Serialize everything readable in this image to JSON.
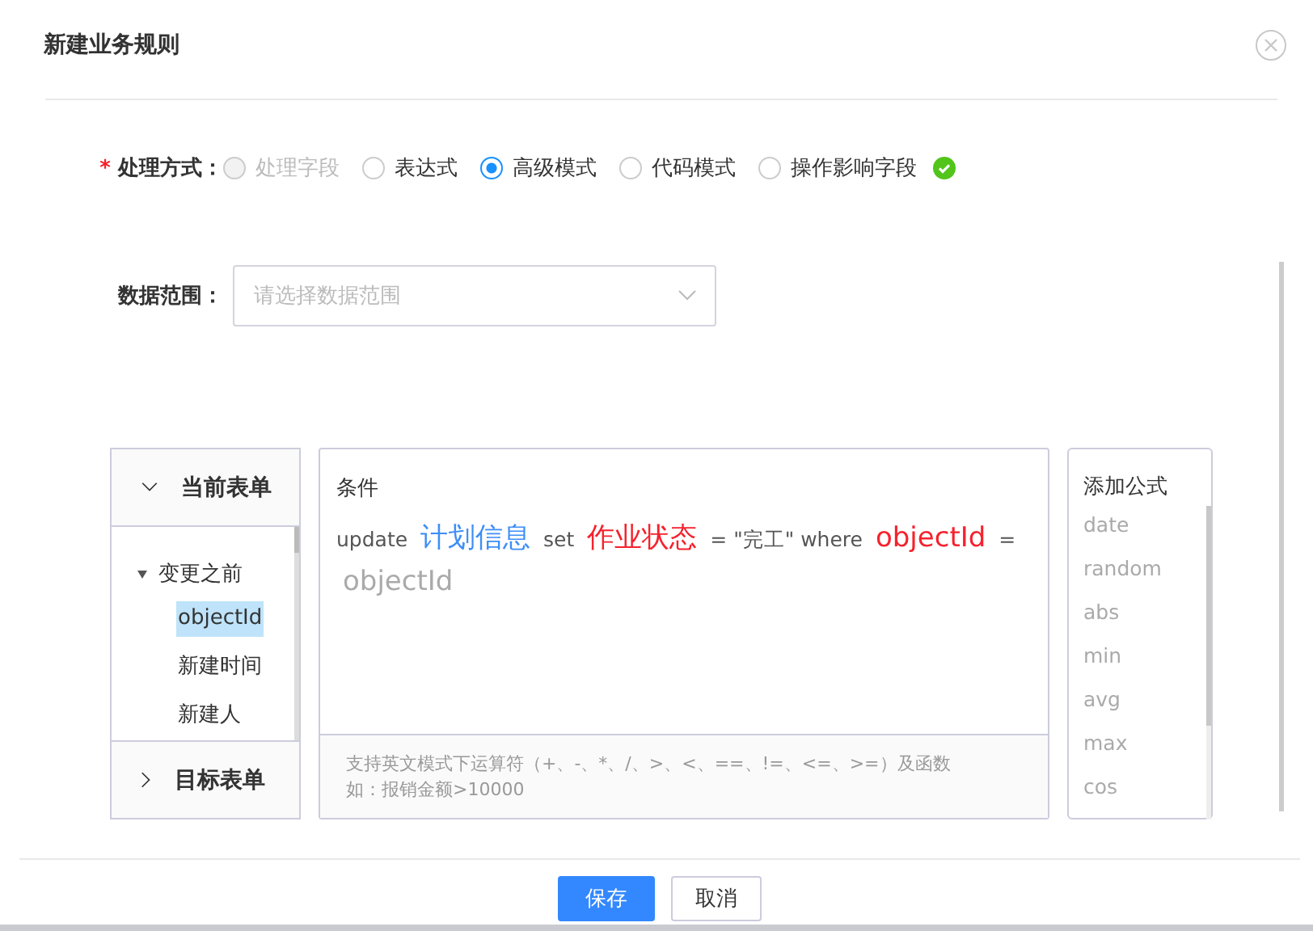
{
  "dialog": {
    "title": "新建业务规则"
  },
  "mode": {
    "label": "处理方式：",
    "required_mark": "*",
    "options": [
      {
        "label": "处理字段",
        "selected": false,
        "disabled": true
      },
      {
        "label": "表达式",
        "selected": false,
        "disabled": false
      },
      {
        "label": "高级模式",
        "selected": true,
        "disabled": false
      },
      {
        "label": "代码模式",
        "selected": false,
        "disabled": false
      },
      {
        "label": "操作影响字段",
        "selected": false,
        "disabled": false
      }
    ]
  },
  "data_range": {
    "label": "数据范围：",
    "placeholder": "请选择数据范围"
  },
  "field_panel": {
    "sections": [
      {
        "title": "当前表单",
        "expanded": true,
        "tree": [
          {
            "label": "变更之前",
            "expanded": true,
            "children": [
              {
                "label": "objectId",
                "selected": true
              },
              {
                "label": "新建时间",
                "selected": false
              },
              {
                "label": "新建人",
                "selected": false
              }
            ]
          }
        ]
      },
      {
        "title": "目标表单",
        "expanded": false
      }
    ]
  },
  "editor": {
    "title": "条件",
    "tokens": [
      {
        "kind": "keyword",
        "text": "update"
      },
      {
        "kind": "table",
        "text": "计划信息"
      },
      {
        "kind": "keyword",
        "text": "set"
      },
      {
        "kind": "field",
        "text": "作业状态"
      },
      {
        "kind": "keyword",
        "text": "= \"完工\" where"
      },
      {
        "kind": "field",
        "text": "objectId"
      },
      {
        "kind": "keyword",
        "text": "="
      },
      {
        "kind": "value",
        "text": "objectId"
      }
    ],
    "hint": [
      "支持英文模式下运算符（+、-、*、/、>、<、==、!=、<=、>=）及函数",
      "如：报销金额>10000"
    ]
  },
  "formulas": {
    "title": "添加公式",
    "items": [
      "date",
      "random",
      "abs",
      "min",
      "avg",
      "max",
      "cos"
    ]
  },
  "buttons": [
    {
      "label": "保存",
      "primary": true
    },
    {
      "label": "取消",
      "primary": false
    }
  ]
}
